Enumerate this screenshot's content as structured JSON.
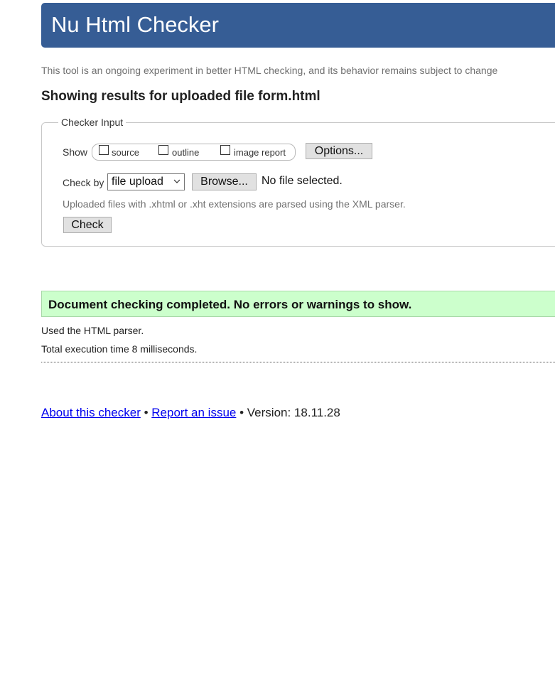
{
  "banner": {
    "title": "Nu Html Checker"
  },
  "tagline": "This tool is an ongoing experiment in better HTML checking, and its behavior remains subject to change",
  "results_heading": "Showing results for uploaded file form.html",
  "checker_input": {
    "legend": "Checker Input",
    "show_label": "Show",
    "show_options": [
      {
        "label": "source",
        "checked": false
      },
      {
        "label": "outline",
        "checked": false
      },
      {
        "label": "image report",
        "checked": false
      }
    ],
    "options_button": "Options...",
    "check_by_label": "Check by",
    "check_by_selected": "file upload",
    "browse_button": "Browse...",
    "file_status": "No file selected.",
    "note": "Uploaded files with .xhtml or .xht extensions are parsed using the XML parser.",
    "check_button": "Check"
  },
  "result": {
    "success_message": "Document checking completed. No errors or warnings to show.",
    "parser_line": "Used the HTML parser.",
    "timing_line": "Total execution time 8 milliseconds."
  },
  "footer": {
    "about_link": "About this checker",
    "separator": "•",
    "report_link": "Report an issue",
    "version": "Version: 18.11.28"
  },
  "colors": {
    "banner_bg": "#365d95",
    "success_bg": "#ccffcc",
    "link": "#0000ee"
  }
}
